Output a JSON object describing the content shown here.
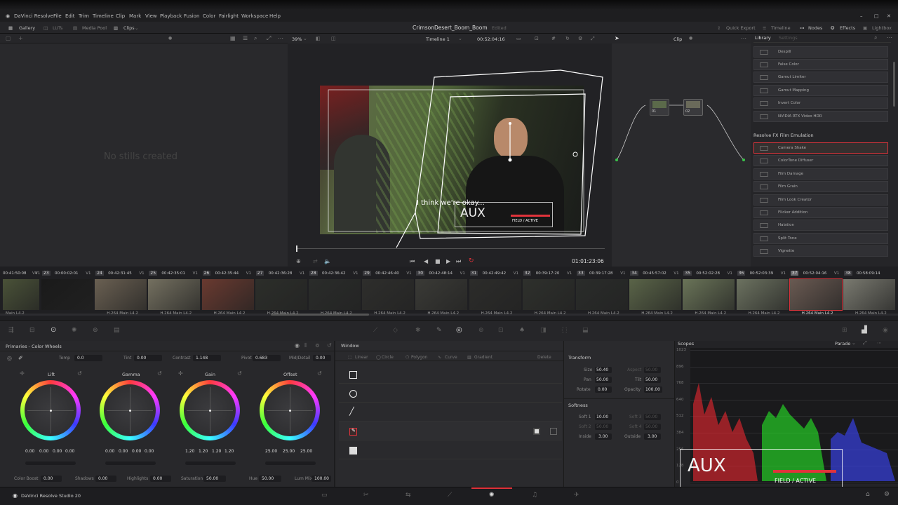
{
  "menubar": {
    "app": "DaVinci Resolve",
    "items": [
      "File",
      "Edit",
      "Trim",
      "Timeline",
      "Clip",
      "Mark",
      "View",
      "Playback",
      "Fusion",
      "Color",
      "Fairlight",
      "Workspace",
      "Help"
    ]
  },
  "toolbar": {
    "gallery": "Gallery",
    "luts": "LUTs",
    "media_pool": "Media Pool",
    "clips": "Clips",
    "project_title": "CrimsonDesert_Boom_Boom",
    "project_status": "Edited",
    "quick_export": "Quick Export",
    "timeline": "Timeline",
    "nodes": "Nodes",
    "effects": "Effects",
    "lightbox": "Lightbox"
  },
  "gallery": {
    "empty_text": "No stills created"
  },
  "viewer": {
    "zoom": "39%",
    "timeline_name": "Timeline 1",
    "source_tc": "00:52:04:16",
    "clip_label": "Clip",
    "playhead_tc": "01:01:23:06",
    "subtitle": "I think we're okay...",
    "aux": "AUX",
    "field": "FIELD / ACTIVE"
  },
  "nodes": {
    "node1": "01",
    "node2": "02"
  },
  "library": {
    "tab_library": "Library",
    "tab_settings": "Settings",
    "items_top": [
      "Despill",
      "False Color",
      "Gamut Limiter",
      "Gamut Mapping",
      "Invert Color",
      "NVIDIA RTX Video HDR"
    ],
    "section": "Resolve FX Film Emulation",
    "items_section": [
      "Camera Shake",
      "ColorTone Diffuser",
      "Film Damage",
      "Film Grain",
      "Film Look Creator",
      "Flicker Addition",
      "Halation",
      "Split Tone",
      "Vignette"
    ],
    "selected": "Camera Shake"
  },
  "clips": [
    {
      "num": "",
      "tc": "00:41:50:08",
      "track": "V1",
      "codec": "Main L4.2"
    },
    {
      "num": "23",
      "tc": "00:00:02:01",
      "track": "V4",
      "codec": ""
    },
    {
      "num": "24",
      "tc": "00:42:31:45",
      "track": "V1",
      "codec": "H.264 Main L4.2"
    },
    {
      "num": "25",
      "tc": "00:42:35:01",
      "track": "V1",
      "codec": "H.264 Main L4.2"
    },
    {
      "num": "26",
      "tc": "00:42:35:44",
      "track": "V1",
      "codec": "H.264 Main L4.2"
    },
    {
      "num": "27",
      "tc": "00:42:36:28",
      "track": "V1",
      "codec": "H.264 Main L4.2"
    },
    {
      "num": "28",
      "tc": "00:42:36:42",
      "track": "V1",
      "codec": "H.264 Main L4.2"
    },
    {
      "num": "29",
      "tc": "00:42:46:40",
      "track": "V1",
      "codec": "H.264 Main L4.2"
    },
    {
      "num": "30",
      "tc": "00:42:48:14",
      "track": "V1",
      "codec": "H.264 Main L4.2"
    },
    {
      "num": "31",
      "tc": "00:42:49:42",
      "track": "V1",
      "codec": "H.264 Main L4.2"
    },
    {
      "num": "32",
      "tc": "00:39:17:20",
      "track": "V1",
      "codec": "H.264 Main L4.2"
    },
    {
      "num": "33",
      "tc": "00:39:17:28",
      "track": "V1",
      "codec": "H.264 Main L4.2"
    },
    {
      "num": "34",
      "tc": "00:45:57:02",
      "track": "V1",
      "codec": "H.264 Main L4.2"
    },
    {
      "num": "35",
      "tc": "00:52:02:28",
      "track": "V1",
      "codec": "H.264 Main L4.2"
    },
    {
      "num": "36",
      "tc": "00:52:03:39",
      "track": "V1",
      "codec": "H.264 Main L4.2"
    },
    {
      "num": "37",
      "tc": "00:52:04:16",
      "track": "V1",
      "codec": "H.264 Main L4.2"
    },
    {
      "num": "38",
      "tc": "00:58:09:14",
      "track": "V1",
      "codec": "H.264 Main L4.2"
    }
  ],
  "primaries": {
    "title": "Primaries - Color Wheels",
    "temp_label": "Temp",
    "temp": "0.0",
    "tint_label": "Tint",
    "tint": "0.00",
    "contrast_label": "Contrast",
    "contrast": "1.148",
    "pivot_label": "Pivot",
    "pivot": "0.683",
    "middetail_label": "Mid/Detail",
    "middetail": "0.00",
    "wheels": [
      {
        "name": "Lift",
        "values": [
          "0.00",
          "0.00",
          "0.00",
          "0.00"
        ]
      },
      {
        "name": "Gamma",
        "values": [
          "0.00",
          "0.00",
          "0.00",
          "0.00"
        ]
      },
      {
        "name": "Gain",
        "values": [
          "1.20",
          "1.20",
          "1.20",
          "1.20"
        ]
      },
      {
        "name": "Offset",
        "values": [
          "25.00",
          "25.00",
          "25.00"
        ]
      }
    ],
    "colorboost_label": "Color Boost",
    "colorboost": "0.00",
    "shadows_label": "Shadows",
    "shadows": "0.00",
    "highlights_label": "Highlights",
    "highlights": "0.00",
    "saturation_label": "Saturation",
    "saturation": "50.00",
    "hue_label": "Hue",
    "hue": "50.00",
    "lummix_label": "Lum Mix",
    "lummix": "100.00"
  },
  "window": {
    "title": "Window",
    "linear": "Linear",
    "circle": "Circle",
    "polygon": "Polygon",
    "curve": "Curve",
    "gradient": "Gradient",
    "delete": "Delete"
  },
  "transform": {
    "title": "Transform",
    "size_label": "Size",
    "size": "50.40",
    "aspect_label": "Aspect",
    "aspect": "50.00",
    "pan_label": "Pan",
    "pan": "50.00",
    "tilt_label": "Tilt",
    "tilt": "50.00",
    "rotate_label": "Rotate",
    "rotate": "0.00",
    "opacity_label": "Opacity",
    "opacity": "100.00",
    "softness_title": "Softness",
    "soft1_label": "Soft 1",
    "soft1": "10.00",
    "soft2_label": "Soft 2",
    "soft2": "50.00",
    "soft3_label": "Soft 3",
    "soft3": "50.00",
    "soft4_label": "Soft 4",
    "soft4": "50.00",
    "inside_label": "Inside",
    "inside": "3.00",
    "outside_label": "Outside",
    "outside": "3.00"
  },
  "scopes": {
    "title": "Scopes",
    "mode": "Parade",
    "ticks": [
      "1023",
      "896",
      "768",
      "640",
      "512",
      "384",
      "256",
      "128",
      "0"
    ],
    "aux": "AUX",
    "field": "FIELD / ACTIVE"
  },
  "footer": {
    "app_name": "DaVinci Resolve Studio 20"
  },
  "colors": {
    "accent_red": "#e0333b",
    "panel": "#28282b",
    "selected_border": "#d8343b"
  }
}
